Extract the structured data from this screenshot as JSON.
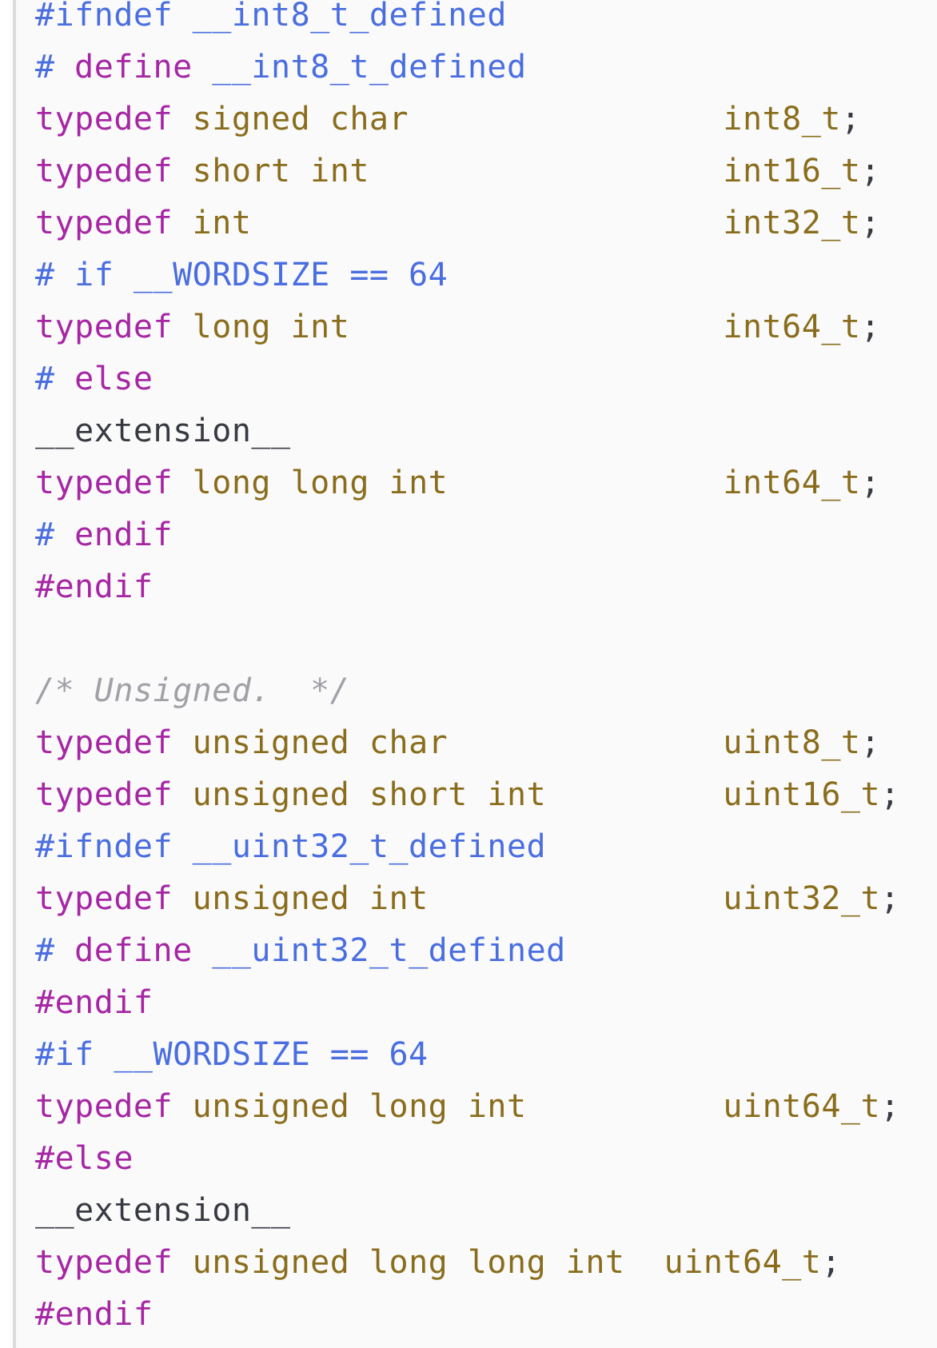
{
  "colors": {
    "background": "#fafafa",
    "border": "#dcdcdc",
    "keyword": "#a626a4",
    "type": "#8a6d1c",
    "macro": "#4a6ee0",
    "comment": "#a0a1a7",
    "plain": "#383a42"
  },
  "lines": [
    [
      {
        "t": "#ifndef ",
        "c": "mac"
      },
      {
        "t": "__int8_t_defined",
        "c": "mac"
      }
    ],
    [
      {
        "t": "# ",
        "c": "mac"
      },
      {
        "t": "define",
        "c": "kw"
      },
      {
        "t": " __int8_t_defined",
        "c": "mac"
      }
    ],
    [
      {
        "t": "typedef",
        "c": "kw"
      },
      {
        "t": " ",
        "c": "pl"
      },
      {
        "t": "signed char",
        "c": "ty"
      },
      {
        "t": "                ",
        "c": "pl"
      },
      {
        "t": "int8_t",
        "c": "ty"
      },
      {
        "t": ";",
        "c": "pl"
      }
    ],
    [
      {
        "t": "typedef",
        "c": "kw"
      },
      {
        "t": " ",
        "c": "pl"
      },
      {
        "t": "short int",
        "c": "ty"
      },
      {
        "t": "                  ",
        "c": "pl"
      },
      {
        "t": "int16_t",
        "c": "ty"
      },
      {
        "t": ";",
        "c": "pl"
      }
    ],
    [
      {
        "t": "typedef",
        "c": "kw"
      },
      {
        "t": " ",
        "c": "pl"
      },
      {
        "t": "int",
        "c": "ty"
      },
      {
        "t": "                        ",
        "c": "pl"
      },
      {
        "t": "int32_t",
        "c": "ty"
      },
      {
        "t": ";",
        "c": "pl"
      }
    ],
    [
      {
        "t": "# if __WORDSIZE == 64",
        "c": "mac"
      }
    ],
    [
      {
        "t": "typedef",
        "c": "kw"
      },
      {
        "t": " ",
        "c": "pl"
      },
      {
        "t": "long int",
        "c": "ty"
      },
      {
        "t": "                   ",
        "c": "pl"
      },
      {
        "t": "int64_t",
        "c": "ty"
      },
      {
        "t": ";",
        "c": "pl"
      }
    ],
    [
      {
        "t": "# ",
        "c": "mac"
      },
      {
        "t": "else",
        "c": "kw"
      }
    ],
    [
      {
        "t": "__extension__",
        "c": "pl"
      }
    ],
    [
      {
        "t": "typedef",
        "c": "kw"
      },
      {
        "t": " ",
        "c": "pl"
      },
      {
        "t": "long long int",
        "c": "ty"
      },
      {
        "t": "              ",
        "c": "pl"
      },
      {
        "t": "int64_t",
        "c": "ty"
      },
      {
        "t": ";",
        "c": "pl"
      }
    ],
    [
      {
        "t": "# ",
        "c": "mac"
      },
      {
        "t": "endif",
        "c": "kw"
      }
    ],
    [
      {
        "t": "#endif",
        "c": "kw"
      }
    ],
    [
      {
        "t": "",
        "c": "pl"
      }
    ],
    [
      {
        "t": "/* Unsigned.  */",
        "c": "cm"
      }
    ],
    [
      {
        "t": "typedef",
        "c": "kw"
      },
      {
        "t": " ",
        "c": "pl"
      },
      {
        "t": "unsigned char",
        "c": "ty"
      },
      {
        "t": "              ",
        "c": "pl"
      },
      {
        "t": "uint8_t",
        "c": "ty"
      },
      {
        "t": ";",
        "c": "pl"
      }
    ],
    [
      {
        "t": "typedef",
        "c": "kw"
      },
      {
        "t": " ",
        "c": "pl"
      },
      {
        "t": "unsigned short int",
        "c": "ty"
      },
      {
        "t": "         ",
        "c": "pl"
      },
      {
        "t": "uint16_t",
        "c": "ty"
      },
      {
        "t": ";",
        "c": "pl"
      }
    ],
    [
      {
        "t": "#ifndef __uint32_t_defined",
        "c": "mac"
      }
    ],
    [
      {
        "t": "typedef",
        "c": "kw"
      },
      {
        "t": " ",
        "c": "pl"
      },
      {
        "t": "unsigned int",
        "c": "ty"
      },
      {
        "t": "               ",
        "c": "pl"
      },
      {
        "t": "uint32_t",
        "c": "ty"
      },
      {
        "t": ";",
        "c": "pl"
      }
    ],
    [
      {
        "t": "# ",
        "c": "mac"
      },
      {
        "t": "define",
        "c": "kw"
      },
      {
        "t": " __uint32_t_defined",
        "c": "mac"
      }
    ],
    [
      {
        "t": "#endif",
        "c": "kw"
      }
    ],
    [
      {
        "t": "#if __WORDSIZE == 64",
        "c": "mac"
      }
    ],
    [
      {
        "t": "typedef",
        "c": "kw"
      },
      {
        "t": " ",
        "c": "pl"
      },
      {
        "t": "unsigned long int",
        "c": "ty"
      },
      {
        "t": "          ",
        "c": "pl"
      },
      {
        "t": "uint64_t",
        "c": "ty"
      },
      {
        "t": ";",
        "c": "pl"
      }
    ],
    [
      {
        "t": "#else",
        "c": "kw"
      }
    ],
    [
      {
        "t": "__extension__",
        "c": "pl"
      }
    ],
    [
      {
        "t": "typedef",
        "c": "kw"
      },
      {
        "t": " ",
        "c": "pl"
      },
      {
        "t": "unsigned long long int",
        "c": "ty"
      },
      {
        "t": "  ",
        "c": "pl"
      },
      {
        "t": "uint64_t",
        "c": "ty"
      },
      {
        "t": ";",
        "c": "pl"
      }
    ],
    [
      {
        "t": "#endif",
        "c": "kw"
      }
    ]
  ]
}
